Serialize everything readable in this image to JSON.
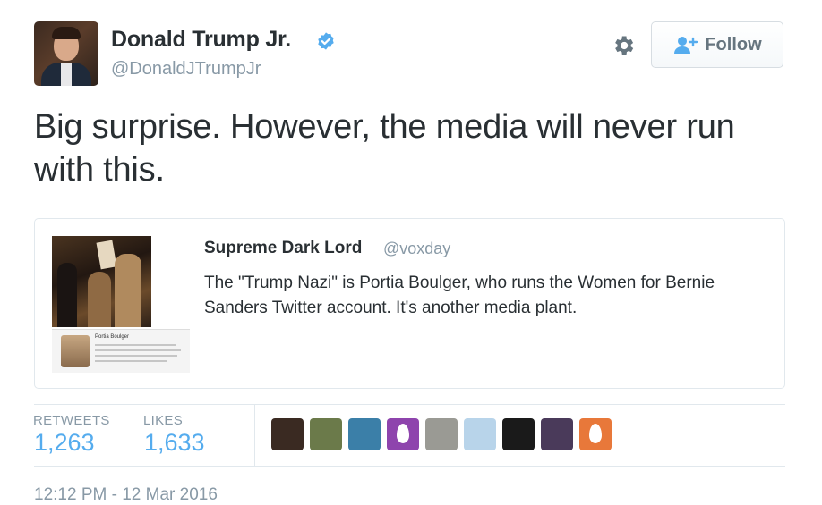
{
  "author": {
    "name": "Donald Trump Jr.",
    "handle": "@DonaldJTrumpJr",
    "verified_icon": "verified-badge-icon"
  },
  "actions": {
    "settings_icon": "gear-icon",
    "follow_label": "Follow",
    "follow_icon": "add-user-icon"
  },
  "tweet": {
    "text": "Big surprise. However, the media will never run with this."
  },
  "quoted_tweet": {
    "name": "Supreme Dark Lord",
    "handle": "@voxday",
    "text": "The \"Trump Nazi\" is Portia Boulger, who runs the Women for Bernie Sanders Twitter account. It's another media plant.",
    "media_caption": "Portia Boulger"
  },
  "stats": {
    "retweets_label": "RETWEETS",
    "retweets_value": "1,263",
    "likes_label": "LIKES",
    "likes_value": "1,633"
  },
  "likers": [
    {
      "name": "liker-avatar-1",
      "color": "#3a2a22"
    },
    {
      "name": "liker-avatar-2",
      "color": "#6b7a4a"
    },
    {
      "name": "liker-avatar-3",
      "color": "#3b7fa8"
    },
    {
      "name": "liker-avatar-egg-purple",
      "color": "#8e44ad"
    },
    {
      "name": "liker-avatar-5",
      "color": "#9a9a94"
    },
    {
      "name": "liker-avatar-6",
      "color": "#b8d4ea"
    },
    {
      "name": "liker-avatar-7",
      "color": "#1a1a1a"
    },
    {
      "name": "liker-avatar-8",
      "color": "#4a3a5a"
    },
    {
      "name": "liker-avatar-egg-orange",
      "color": "#e8783a"
    }
  ],
  "timestamp": "12:12 PM - 12 Mar 2016",
  "colors": {
    "link_blue": "#55acee",
    "muted_gray": "#8899a6",
    "text": "#292f33"
  }
}
